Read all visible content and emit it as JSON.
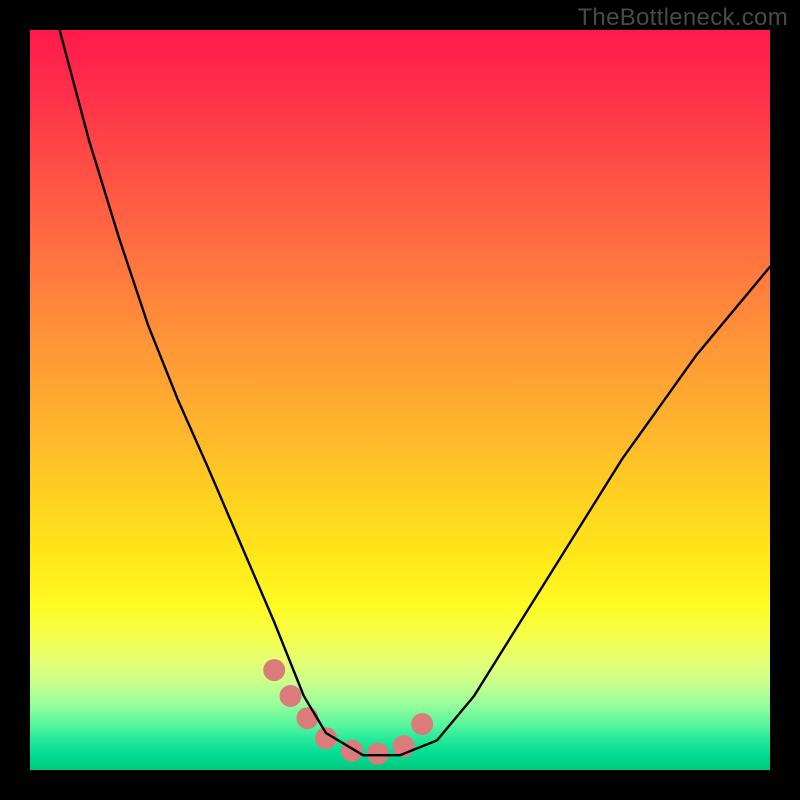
{
  "watermark": "TheBottleneck.com",
  "chart_data": {
    "type": "line",
    "title": "",
    "xlabel": "",
    "ylabel": "",
    "xlim": [
      0,
      100
    ],
    "ylim": [
      0,
      100
    ],
    "grid": false,
    "series": [
      {
        "name": "curve",
        "color": "#000000",
        "x": [
          4,
          8,
          12,
          16,
          20,
          24,
          27,
          30,
          33,
          35,
          37,
          40,
          45,
          50,
          55,
          60,
          65,
          70,
          75,
          80,
          85,
          90,
          95,
          100
        ],
        "values": [
          100,
          85,
          72,
          60,
          50,
          41,
          34,
          27,
          20,
          15,
          10,
          5,
          2,
          2,
          4,
          10,
          18,
          26,
          34,
          42,
          49,
          56,
          62,
          68
        ]
      }
    ],
    "markers": {
      "name": "highlight-dots",
      "color": "#db7b7b",
      "radius_px": 11,
      "x": [
        33.0,
        35.2,
        37.5,
        40.0,
        43.5,
        47.0,
        50.5,
        53.0
      ],
      "y": [
        13.5,
        10.0,
        7.0,
        4.3,
        2.6,
        2.2,
        3.2,
        6.2
      ]
    },
    "background_gradient": {
      "type": "vertical",
      "stops": [
        {
          "pos": 0.0,
          "color": "#ff1a4d"
        },
        {
          "pos": 0.5,
          "color": "#ffb82c"
        },
        {
          "pos": 0.8,
          "color": "#fdfb25"
        },
        {
          "pos": 1.0,
          "color": "#00c97e"
        }
      ]
    }
  }
}
